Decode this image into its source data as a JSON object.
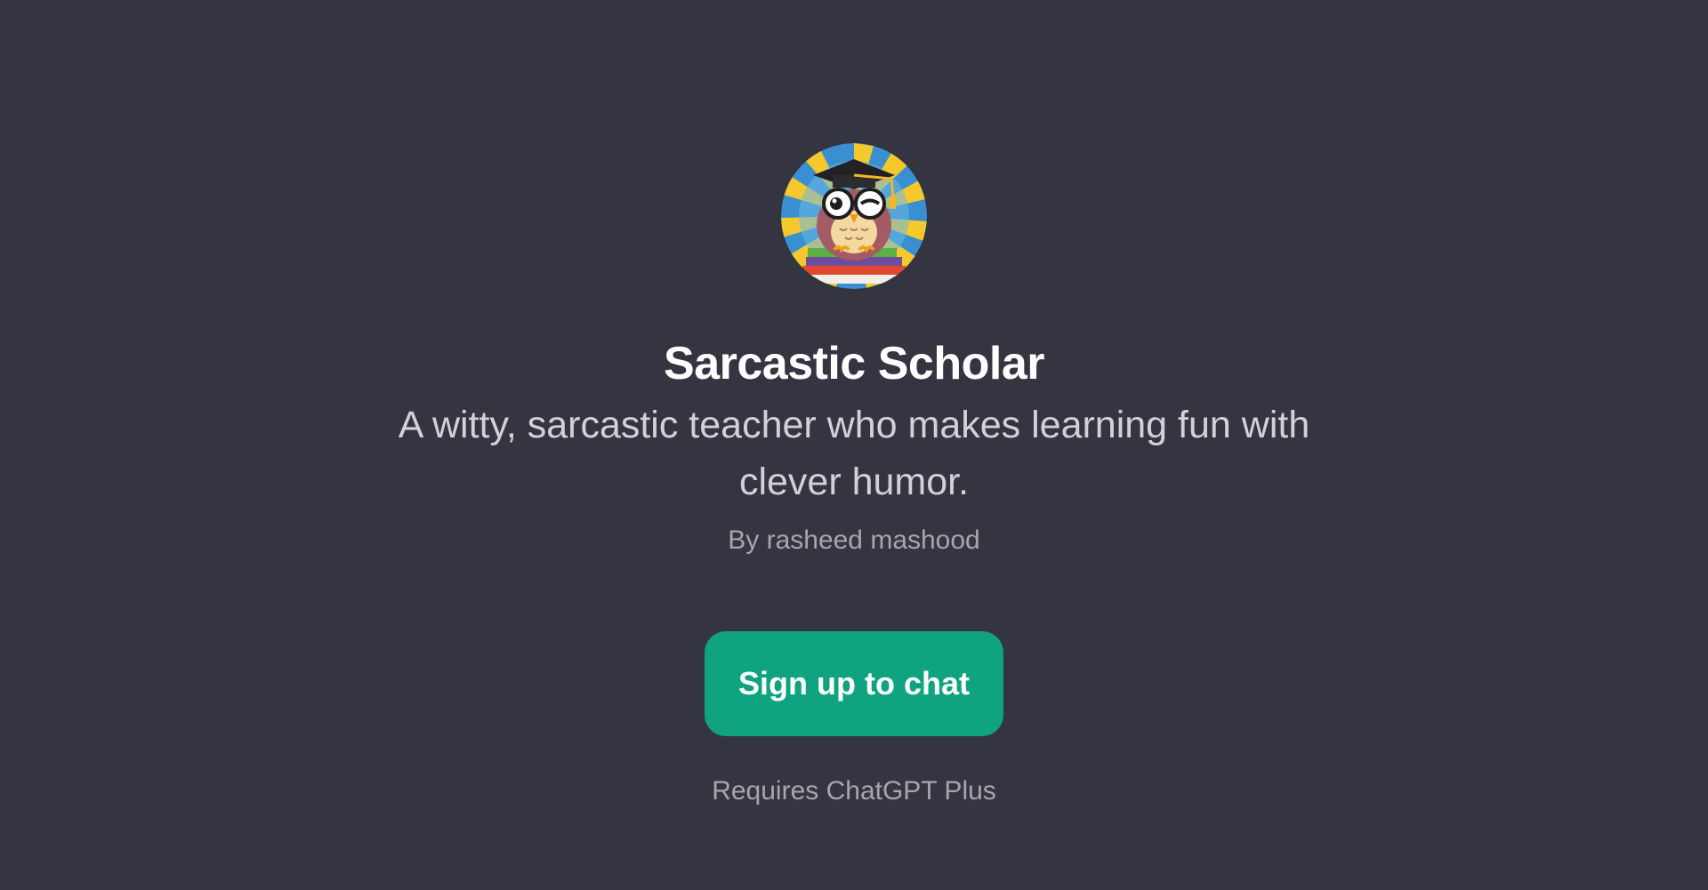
{
  "gpt": {
    "avatar_icon": "owl-graduate-icon",
    "title": "Sarcastic Scholar",
    "description": "A witty, sarcastic teacher who makes learning fun with clever humor.",
    "author": "By rasheed mashood"
  },
  "actions": {
    "signup_label": "Sign up to chat",
    "requirement_note": "Requires ChatGPT Plus"
  },
  "colors": {
    "background": "#343541",
    "accent": "#10a37f",
    "title": "#ffffff",
    "description": "#d1d1d8",
    "muted": "#a6a6b0"
  }
}
